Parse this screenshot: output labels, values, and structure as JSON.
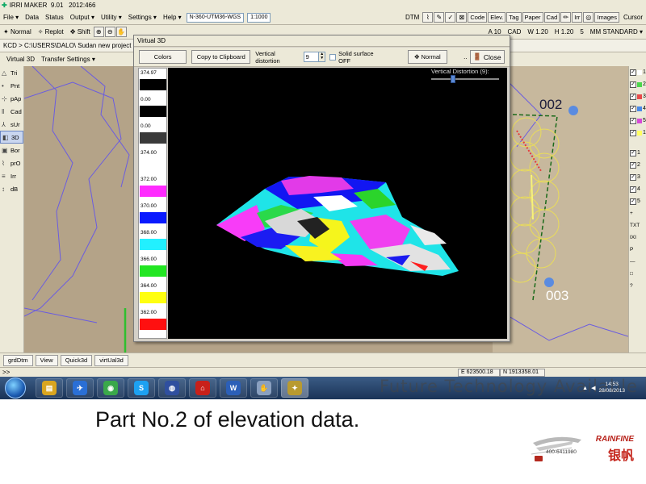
{
  "titlebar": {
    "app": "IRRI MAKER",
    "version": "9.01",
    "build": "2012:466"
  },
  "menu": {
    "items": [
      "File ▾",
      "Data",
      "Status",
      "Output ▾",
      "Utility ▾",
      "Settings ▾",
      "Help ▾"
    ],
    "projection": "N-360-UTM36-WGS",
    "scale": "1:1000",
    "right_buttons": [
      "DTM",
      "Code",
      "Elev.",
      "Tag",
      "Paper",
      "Cad",
      "Irr",
      "Images",
      "Cursor"
    ]
  },
  "toolbar2": {
    "items": [
      "Normal",
      "Replot",
      "Shift"
    ],
    "right_items": [
      "A 10",
      "CAD",
      "W 1.20",
      "H 1.20",
      "5",
      "MM STANDARD ▾"
    ]
  },
  "pathbar": {
    "text": "KCD > C:\\USERS\\DALO\\ Sudan new project 2.mal"
  },
  "tabbar1": {
    "tabs": [
      "Virtual 3D",
      "Transfer Settings ▾"
    ]
  },
  "left_panel": {
    "items": [
      {
        "icon": "triangle-icon",
        "glyph": "△",
        "label": "Tri"
      },
      {
        "icon": "point-icon",
        "glyph": "•",
        "label": "Pnt"
      },
      {
        "icon": "point-add-icon",
        "glyph": "⊹",
        "label": "pAp"
      },
      {
        "icon": "cad-icon",
        "glyph": "‖",
        "label": "Cad"
      },
      {
        "icon": "survey-icon",
        "glyph": "⅄",
        "label": "sUr"
      },
      {
        "icon": "cube-icon",
        "glyph": "◧",
        "label": "3D"
      },
      {
        "icon": "border-icon",
        "glyph": "▣",
        "label": "Bor"
      },
      {
        "icon": "profile-icon",
        "glyph": "⌇",
        "label": "prO"
      },
      {
        "icon": "irrigation-icon",
        "glyph": "≡",
        "label": "Irr"
      },
      {
        "icon": "db-icon",
        "glyph": "↕",
        "label": "dB"
      }
    ]
  },
  "right_panel": {
    "layers": [
      {
        "label": "1",
        "color": "#ffffff"
      },
      {
        "label": "2",
        "color": "#4cd64c"
      },
      {
        "label": "3",
        "color": "#e84a4a"
      },
      {
        "label": "4",
        "color": "#4a8ae8"
      },
      {
        "label": "5",
        "color": "#d84ad8"
      },
      {
        "label": "1",
        "color": "#ffff60"
      }
    ],
    "checked": [
      "1",
      "2",
      "3",
      "4",
      "5"
    ],
    "extra": [
      "+",
      "TXT",
      "IXI",
      "P",
      "—",
      "□",
      "?"
    ]
  },
  "map": {
    "labels": [
      {
        "text": "002"
      },
      {
        "text": "003"
      }
    ]
  },
  "dialog": {
    "title": "Virtual 3D",
    "colors_btn": "Colors",
    "copy_btn": "Copy to Clipboard",
    "distortion_label": "Vertical distortion",
    "distortion_value": "9",
    "solid_label": "Solid surface OFF",
    "normal_btn": "Normal",
    "close_btn": "Close",
    "slider_label": "Vertical Distortion (9):",
    "slider_value": 9
  },
  "legend": [
    {
      "label": "374.97",
      "color": "#000000"
    },
    {
      "label": "0.00",
      "color": "#000000"
    },
    {
      "label": "0.00",
      "color": "#3a3a3a"
    },
    {
      "label": "374.00",
      "color": "#ffffff"
    },
    {
      "label": "372.00",
      "color": "#ff2bff"
    },
    {
      "label": "370.00",
      "color": "#0a1aff"
    },
    {
      "label": "368.00",
      "color": "#22f0ff"
    },
    {
      "label": "366.00",
      "color": "#22e622"
    },
    {
      "label": "364.00",
      "color": "#ffff10"
    },
    {
      "label": "362.00",
      "color": "#ff1010"
    }
  ],
  "bottom_tabs": [
    "grdDtm",
    "View",
    "Quick3d",
    "virtUal3d"
  ],
  "status": {
    "arrows": ">>",
    "e": "E 623500.18",
    "n": "N 1913358.01"
  },
  "taskbar": {
    "apps": [
      {
        "icon": "folder-icon",
        "glyph": "▤",
        "bg": "#d9a520"
      },
      {
        "icon": "outlook-icon",
        "glyph": "✈",
        "bg": "#2a6fd6"
      },
      {
        "icon": "chrome-icon",
        "glyph": "◉",
        "bg": "#3aa84a"
      },
      {
        "icon": "skype-icon",
        "glyph": "S",
        "bg": "#1da1f2"
      },
      {
        "icon": "earth-icon",
        "glyph": "◍",
        "bg": "#2f4f9f"
      },
      {
        "icon": "acrobat-icon",
        "glyph": "⌂",
        "bg": "#c8201a"
      },
      {
        "icon": "word-icon",
        "glyph": "W",
        "bg": "#2b5fb8"
      },
      {
        "icon": "hand-icon",
        "glyph": "✋",
        "bg": "#8aa0c0"
      },
      {
        "icon": "irrimaker-icon",
        "glyph": "✦",
        "bg": "#b89a30"
      }
    ],
    "time": "14:53",
    "date": "28/08/2013"
  },
  "watermark": "Future Technology Available Now",
  "caption": "Part No.2 of elevation data.",
  "logo": {
    "en": "RAINFINE",
    "cn": "银帆",
    "tel": "400-6411980"
  }
}
